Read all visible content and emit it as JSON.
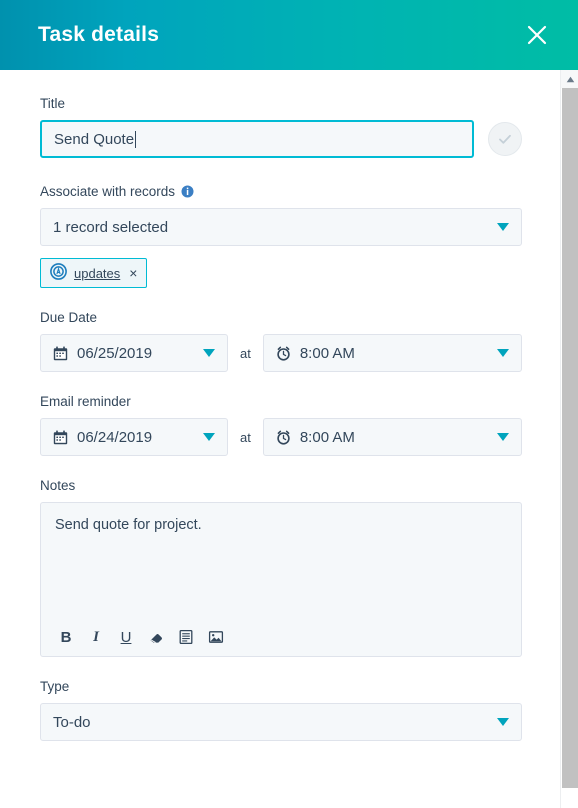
{
  "header": {
    "title": "Task details",
    "close_label": "×",
    "gradient_start": "#0091ae",
    "gradient_end": "#00bda5"
  },
  "form": {
    "title_field": {
      "label": "Title",
      "value": "Send Quote",
      "placeholder": "Title",
      "focused": true,
      "focus_color": "#00bbd4"
    },
    "save_button": {
      "name": "checkmark-confirm",
      "enabled": false
    },
    "associate_field": {
      "label": "Associate with records",
      "info_tooltip_icon": "info-icon",
      "selected_value": "1 record selected",
      "chips": [
        {
          "label": "updates",
          "icon": "company-badge-icon",
          "remove_label": "×"
        }
      ]
    },
    "due_date": {
      "label": "Due Date",
      "date_value": "06/25/2019",
      "date_icon": "calendar-icon",
      "separator": "at",
      "time_value": "8:00 AM",
      "time_icon": "alarm-clock-icon"
    },
    "email_reminder": {
      "label": "Email reminder",
      "date_value": "06/24/2019",
      "date_icon": "calendar-icon",
      "separator": "at",
      "time_value": "8:00 AM",
      "time_icon": "alarm-clock-icon"
    },
    "notes": {
      "label": "Notes",
      "value": "Send quote for project.",
      "toolbar": [
        {
          "name": "bold-icon",
          "label": "B"
        },
        {
          "name": "italic-icon",
          "label": "I"
        },
        {
          "name": "underline-icon",
          "label": "U"
        },
        {
          "name": "clear-formatting-eraser-icon",
          "label": ""
        },
        {
          "name": "bulleted-list-icon",
          "label": ""
        },
        {
          "name": "insert-image-icon",
          "label": ""
        }
      ]
    },
    "type_field": {
      "label": "Type",
      "value": "To-do"
    }
  },
  "scrollbar": {
    "up_arrow": "scroll-up-arrow"
  }
}
